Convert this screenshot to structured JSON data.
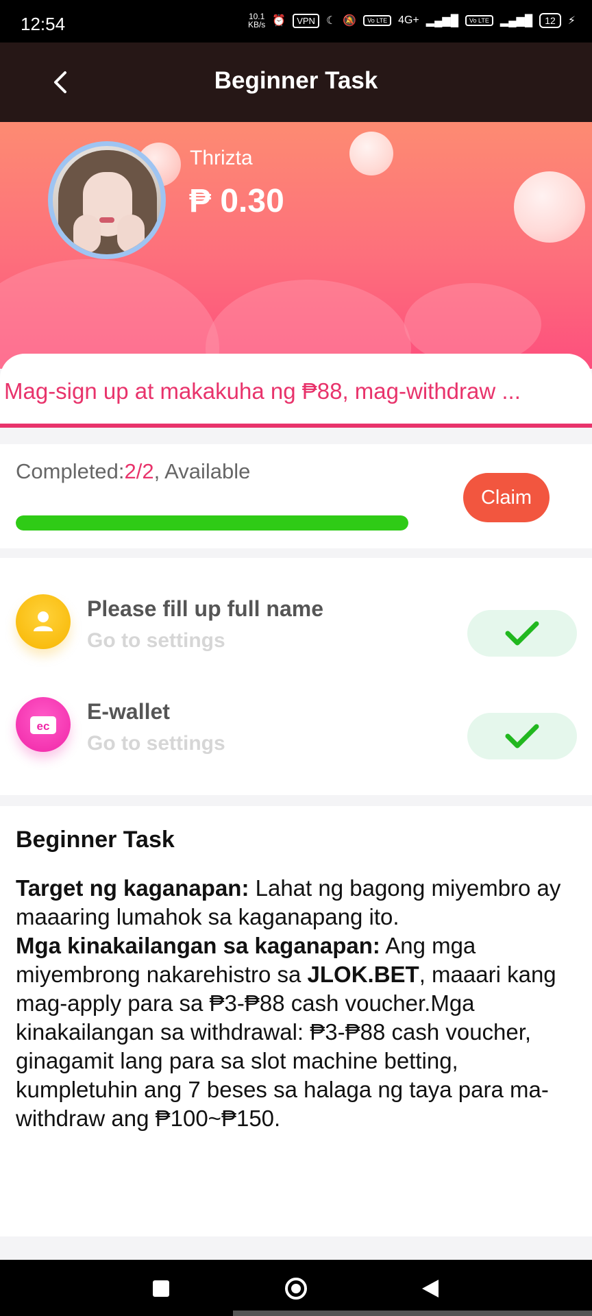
{
  "status_bar": {
    "time": "12:54",
    "net_speed_value": "10.1",
    "net_speed_unit": "KB/s",
    "vpn": "VPN",
    "volte1": "Vo LTE",
    "network": "4G+",
    "volte2": "Vo LTE",
    "battery": "12"
  },
  "header": {
    "title": "Beginner Task"
  },
  "profile": {
    "name": "Thrizta",
    "balance": "₱ 0.30"
  },
  "notice": {
    "text": "Mag-sign up at makakuha ng ₱88, mag-withdraw ..."
  },
  "progress": {
    "label": "Completed:",
    "count": "2/2",
    "suffix": ", Available",
    "fill_percent": 100,
    "claim_label": "Claim",
    "colors": {
      "fill": "#2fcb16",
      "claim": "#f2563f",
      "accent": "#e8336b"
    }
  },
  "tasks": [
    {
      "title": "Please fill up full name",
      "subtitle": "Go to settings",
      "icon": "user-icon",
      "done": true
    },
    {
      "title": "E-wallet",
      "subtitle": "Go to settings",
      "icon": "wallet-icon",
      "done": true
    }
  ],
  "rules": {
    "title": "Beginner Task",
    "target_label": "Target ng kaganapan:",
    "target_text": " Lahat ng bagong miyembro ay maaaring lumahok sa kaganapang ito.",
    "req_label": "Mga kinakailangan sa kaganapan:",
    "req_text_1": " Ang mga miyembrong nakarehistro sa ",
    "brand": "JLOK.BET",
    "req_text_2": ", maaari kang mag-apply para sa ₱3-₱88 cash voucher.Mga kinakailangan sa withdrawal: ₱3-₱88 cash voucher, ginagamit lang para sa slot machine betting, kumpletuhin ang 7 beses sa halaga ng taya para ma-withdraw ang ₱100~₱150."
  },
  "nav": {
    "icons": [
      "recents-icon",
      "home-icon",
      "back-icon"
    ]
  }
}
